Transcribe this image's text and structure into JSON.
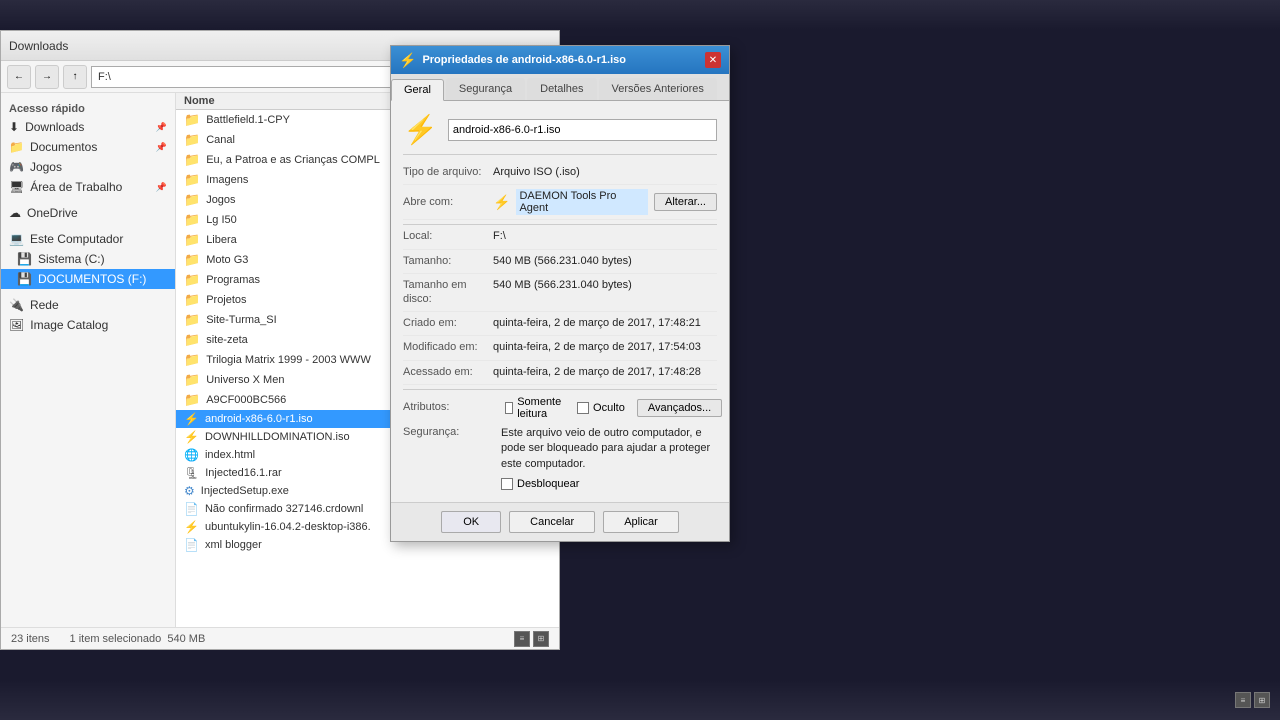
{
  "screen": {
    "bg_color": "#1a1a2e"
  },
  "explorer": {
    "title": "Downloads",
    "address": "F:\\",
    "breadcrumb": "Downloads",
    "statusbar": {
      "count": "23 itens",
      "selected": "1 item selecionado",
      "size": "540 MB"
    },
    "sidebar": {
      "sections": [
        {
          "label": "Acesso rápido",
          "items": [
            {
              "name": "Downloads",
              "icon": "⬇",
              "pinned": true,
              "active": false
            },
            {
              "name": "Documentos",
              "icon": "📁",
              "pinned": true,
              "active": false
            },
            {
              "name": "Jogos",
              "icon": "🎮",
              "pinned": false,
              "active": false
            },
            {
              "name": "Área de Trabalho",
              "icon": "🖥",
              "pinned": true,
              "active": false
            }
          ]
        },
        {
          "label": "",
          "items": [
            {
              "name": "OneDrive",
              "icon": "☁",
              "pinned": false,
              "active": false
            }
          ]
        },
        {
          "label": "",
          "items": [
            {
              "name": "Este Computador",
              "icon": "💻",
              "pinned": false,
              "active": false
            },
            {
              "name": "Sistema (C:)",
              "icon": "💾",
              "pinned": false,
              "active": false
            },
            {
              "name": "DOCUMENTOS (F:)",
              "icon": "💾",
              "pinned": false,
              "active": true
            }
          ]
        },
        {
          "label": "",
          "items": [
            {
              "name": "Rede",
              "icon": "🔌",
              "pinned": false,
              "active": false
            },
            {
              "name": "Image Catalog",
              "icon": "🖼",
              "pinned": false,
              "active": false
            }
          ]
        }
      ]
    },
    "files": [
      {
        "name": "Battlefield.1-CPY",
        "type": "folder",
        "icon": "folder"
      },
      {
        "name": "Canal",
        "type": "folder",
        "icon": "folder"
      },
      {
        "name": "Eu, a Patroa e as Crianças COMPL",
        "type": "folder",
        "icon": "folder"
      },
      {
        "name": "Imagens",
        "type": "folder",
        "icon": "folder"
      },
      {
        "name": "Jogos",
        "type": "folder",
        "icon": "folder"
      },
      {
        "name": "Lg I50",
        "type": "folder",
        "icon": "folder"
      },
      {
        "name": "Libera",
        "type": "folder",
        "icon": "folder"
      },
      {
        "name": "Moto G3",
        "type": "folder",
        "icon": "folder"
      },
      {
        "name": "Programas",
        "type": "folder",
        "icon": "folder"
      },
      {
        "name": "Projetos",
        "type": "folder",
        "icon": "folder"
      },
      {
        "name": "Site-Turma_SI",
        "type": "folder",
        "icon": "folder"
      },
      {
        "name": "site-zeta",
        "type": "folder",
        "icon": "folder"
      },
      {
        "name": "Trilogia Matrix 1999 - 2003  WWW",
        "type": "folder",
        "icon": "folder"
      },
      {
        "name": "Universo X Men",
        "type": "folder",
        "icon": "folder"
      },
      {
        "name": "A9CF000BC566",
        "type": "folder",
        "icon": "folder"
      },
      {
        "name": "android-x86-6.0-r1.iso",
        "type": "iso",
        "icon": "iso",
        "selected": true
      },
      {
        "name": "DOWNHILLDOMINATION.iso",
        "type": "iso",
        "icon": "iso"
      },
      {
        "name": "index.html",
        "type": "html",
        "icon": "html"
      },
      {
        "name": "Injected16.1.rar",
        "type": "rar",
        "icon": "rar"
      },
      {
        "name": "InjectedSetup.exe",
        "type": "exe",
        "icon": "exe"
      },
      {
        "name": "Não confirmado 327146.crdownl",
        "type": "dl",
        "icon": "dl"
      },
      {
        "name": "ubuntukylin-16.04.2-desktop-i386.",
        "type": "iso",
        "icon": "iso2"
      },
      {
        "name": "xml blogger",
        "type": "txt",
        "icon": "txt"
      }
    ],
    "column_header": "Nome"
  },
  "dialog": {
    "title": "Propriedades de android-x86-6.0-r1.iso",
    "icon": "⚡",
    "tabs": [
      {
        "label": "Geral",
        "active": true
      },
      {
        "label": "Segurança",
        "active": false
      },
      {
        "label": "Detalhes",
        "active": false
      },
      {
        "label": "Versões Anteriores",
        "active": false
      }
    ],
    "file_name": "android-x86-6.0-r1.iso",
    "properties": {
      "file_type_label": "Tipo de arquivo:",
      "file_type_value": "Arquivo ISO (.iso)",
      "opens_with_label": "Abre com:",
      "opens_with_app": "DAEMON Tools Pro Agent",
      "opens_with_icon": "⚡",
      "change_btn": "Alterar...",
      "location_label": "Local:",
      "location_value": "F:\\",
      "size_label": "Tamanho:",
      "size_value": "540 MB (566.231.040 bytes)",
      "size_disk_label": "Tamanho em disco:",
      "size_disk_value": "540 MB (566.231.040 bytes)",
      "created_label": "Criado em:",
      "created_value": "quinta-feira, 2 de março de 2017, 17:48:21",
      "modified_label": "Modificado em:",
      "modified_value": "quinta-feira, 2 de março de 2017, 17:54:03",
      "accessed_label": "Acessado em:",
      "accessed_value": "quinta-feira, 2 de março de 2017, 17:48:28",
      "attributes_label": "Atributos:",
      "readonly_label": "Somente leitura",
      "hidden_label": "Oculto",
      "advanced_btn": "Avançados...",
      "security_label": "Segurança:",
      "security_text": "Este arquivo veio de outro computador, e pode ser bloqueado para ajudar a proteger este computador.",
      "unblock_label": "Desbloquear"
    },
    "buttons": {
      "ok": "OK",
      "cancel": "Cancelar",
      "apply": "Aplicar"
    }
  }
}
